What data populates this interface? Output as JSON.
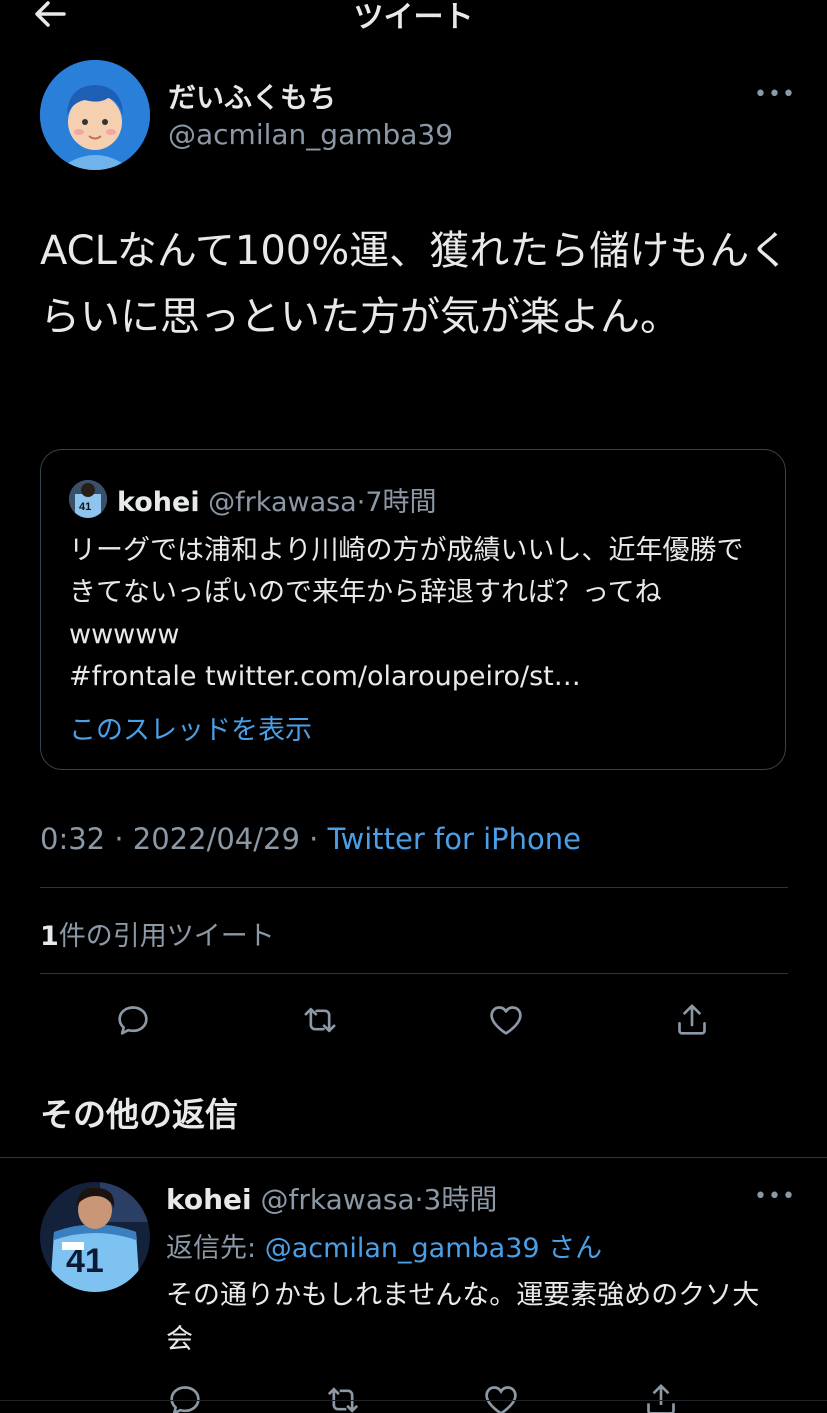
{
  "header": {
    "title": "ツイート",
    "back_icon": "arrow-left-icon"
  },
  "tweet": {
    "display_name": "だいふくもち",
    "handle": "@acmilan_gamba39",
    "text": "ACLなんて100%運、獲れたら儲けもんくらいに思っといた方が気が楽よん。",
    "more_icon": "more-horizontal-icon",
    "quoted": {
      "display_name": "kohei",
      "handle": "@frkawasa",
      "time": "7時間",
      "text_lines": [
        "リーグでは浦和より川崎の方が成績いいし、近年優勝できてないっぽいので来年から辞退すれば？ってね wwwww",
        "#frontale twitter.com/olaroupeiro/st…"
      ],
      "show_thread": "このスレッドを表示"
    },
    "time": "0:32",
    "date": "2022/04/29",
    "source": "Twitter for iPhone",
    "quote_count": "1",
    "quote_label": "件の引用ツイート"
  },
  "actions": {
    "reply_icon": "reply-icon",
    "retweet_icon": "retweet-icon",
    "like_icon": "heart-icon",
    "share_icon": "share-icon"
  },
  "more_replies_title": "その他の返信",
  "reply": {
    "display_name": "kohei",
    "handle": "@frkawasa",
    "time": "3時間",
    "replying_prefix": "返信先: ",
    "replying_to": "@acmilan_gamba39",
    "replying_suffix": " さん",
    "text": "その通りかもしれませんな。運要素強めのクソ大会"
  },
  "colors": {
    "background": "#000000",
    "accent": "#4a9fe6",
    "muted": "#8b98a5",
    "divider": "#2f3336"
  }
}
